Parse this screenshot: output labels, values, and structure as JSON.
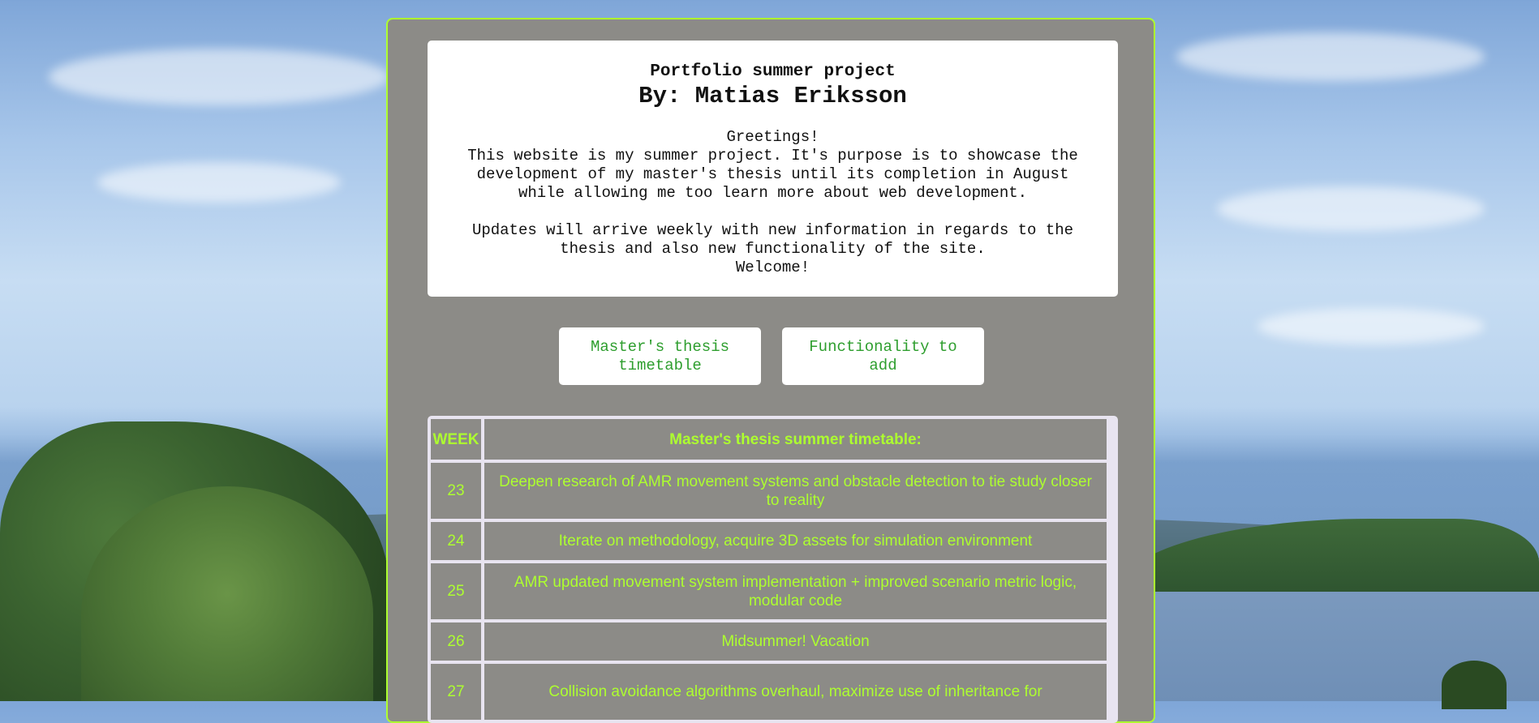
{
  "intro": {
    "subtitle": "Portfolio summer project",
    "title": "By: Matias Eriksson",
    "greeting": "Greetings!",
    "paragraph1": "This website is my summer project. It's purpose is to showcase the development of my master's thesis until its completion in August while allowing me too learn more about web development.",
    "paragraph2": "Updates will arrive weekly with new information in regards to the thesis and also new functionality of the site.",
    "welcome": "Welcome!"
  },
  "buttons": {
    "timetable_label": "Master's thesis timetable",
    "functionality_label": "Functionality to add"
  },
  "table": {
    "headers": [
      "WEEK",
      "Master's thesis summer timetable:"
    ],
    "rows": [
      {
        "week": "23",
        "task": "Deepen research of AMR movement systems and obstacle detection to tie study closer to reality"
      },
      {
        "week": "24",
        "task": "Iterate on methodology, acquire 3D assets for simulation environment"
      },
      {
        "week": "25",
        "task": "AMR updated movement system implementation + improved scenario metric logic, modular code"
      },
      {
        "week": "26",
        "task": "Midsummer! Vacation"
      },
      {
        "week": "27",
        "task": "Collision avoidance algorithms overhaul, maximize use of inheritance for"
      }
    ]
  },
  "colors": {
    "accent": "#adff2f",
    "panel": "#8c8b87",
    "button_text": "#2e9e2e"
  }
}
